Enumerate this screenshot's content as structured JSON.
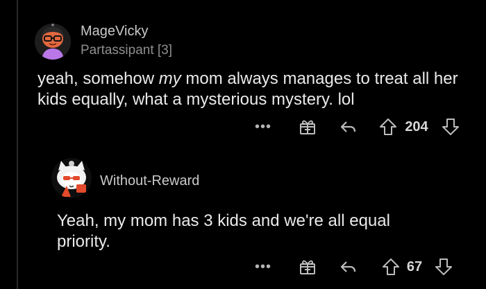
{
  "comments": [
    {
      "author": "MageVicky",
      "flair": "Partassipant [3]",
      "text_before": "yeah, somehow ",
      "text_em": "my",
      "text_after": " mom always manages to treat all her kids equally, what a mysterious mystery. lol",
      "more_label": "•••",
      "score": "204",
      "avatar_icon": "snoo-avatar-glasses",
      "colors": {
        "shirt": "#b977e8",
        "face": "#e2683f"
      }
    },
    {
      "author": "Without-Reward",
      "text": "Yeah, my mom has 3 kids and we're all equal priority.",
      "more_label": "•••",
      "score": "67",
      "avatar_icon": "snoo-avatar-cat-hood",
      "colors": {
        "accent": "#e24a2b",
        "hood": "#f2f2f2"
      }
    }
  ],
  "icons": {
    "award": "gift-box-icon",
    "reply": "reply-arrow-icon",
    "upvote": "upvote-arrow-icon",
    "downvote": "downvote-arrow-icon"
  },
  "theme": {
    "background": "#000000",
    "text": "#eaeaea",
    "muted": "#8f8f8f"
  }
}
